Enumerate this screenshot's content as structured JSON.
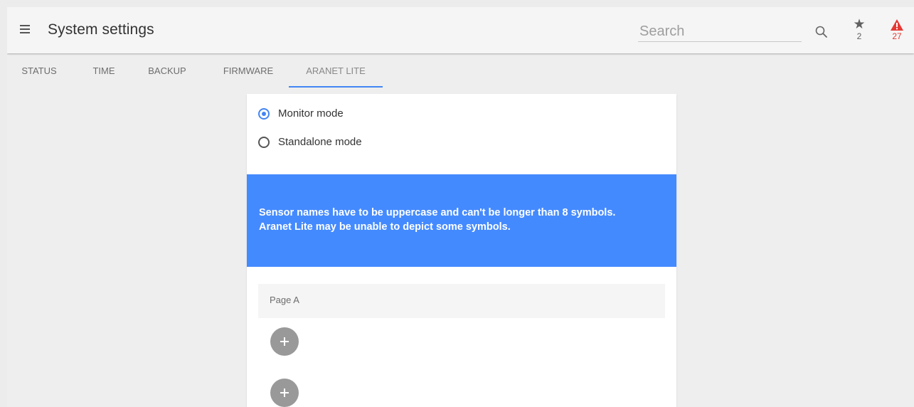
{
  "header": {
    "title": "System settings",
    "search_placeholder": "Search",
    "favorites_count": "2",
    "alerts_count": "27"
  },
  "tabs": [
    {
      "label": "STATUS"
    },
    {
      "label": "TIME"
    },
    {
      "label": "BACKUP"
    },
    {
      "label": "FIRMWARE"
    },
    {
      "label": "ARANET LITE",
      "active": true
    }
  ],
  "mode": {
    "options": [
      {
        "label": "Monitor mode",
        "selected": true
      },
      {
        "label": "Standalone mode",
        "selected": false
      }
    ]
  },
  "banner": {
    "line1": "Sensor names have to be uppercase and can't be longer than 8 symbols.",
    "line2": "Aranet Lite may be unable to depict some symbols."
  },
  "pages": {
    "page_a_label": "Page A"
  },
  "colors": {
    "accent": "#4285f4",
    "banner": "#448aff",
    "alert": "#e53935",
    "add_button": "#999999"
  }
}
